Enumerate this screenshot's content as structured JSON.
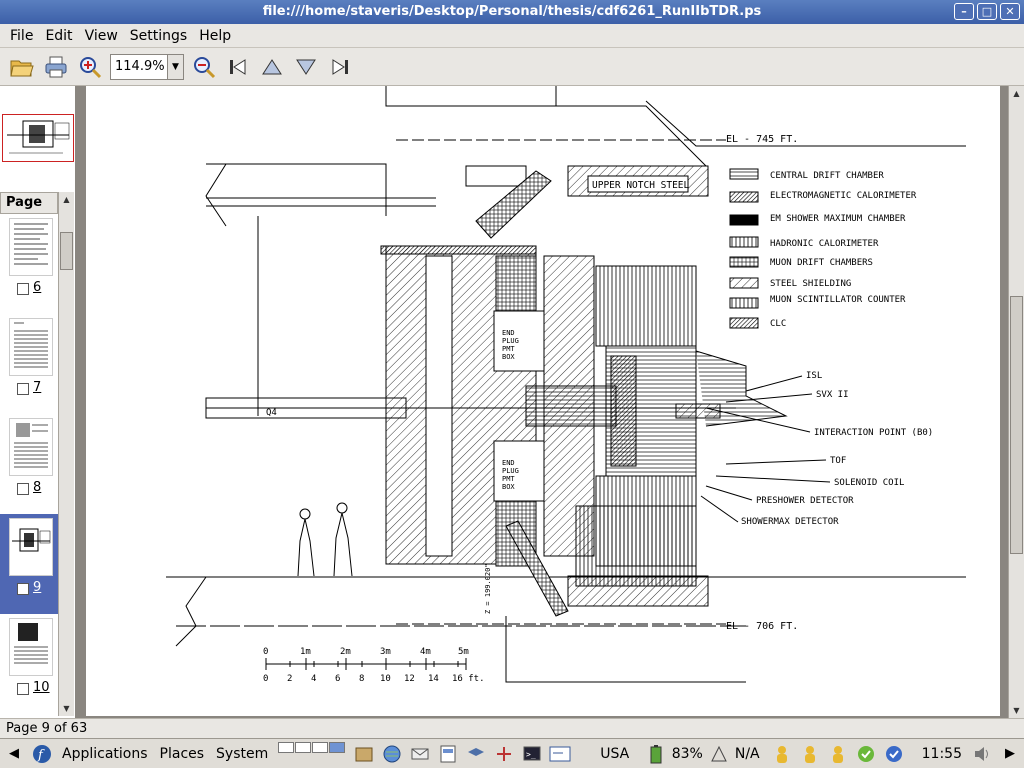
{
  "window": {
    "title": "file:///home/staveris/Desktop/Personal/thesis/cdf6261_RunIIbTDR.ps"
  },
  "menu": [
    "File",
    "Edit",
    "View",
    "Settings",
    "Help"
  ],
  "toolbar": {
    "zoom_value": "114.9%",
    "icons": [
      "open-icon",
      "print-icon",
      "zoom-in-icon",
      "zoom-out-icon",
      "first-page-icon",
      "previous-page-icon",
      "next-page-icon",
      "last-page-icon"
    ]
  },
  "sidebar": {
    "header": "Page",
    "pages": [
      {
        "number": "6",
        "selected": false
      },
      {
        "number": "7",
        "selected": false
      },
      {
        "number": "8",
        "selected": false
      },
      {
        "number": "9",
        "selected": true
      },
      {
        "number": "10",
        "selected": false
      }
    ]
  },
  "document": {
    "elevations": {
      "top": "EL - 745 FT.",
      "bottom": "EL - 706 FT."
    },
    "upper_notch": "UPPER NOTCH STEEL",
    "plug_box": [
      "END",
      "PLUG",
      "PMT",
      "BOX"
    ],
    "q4": "Q4",
    "z_label": "Z = 199.020\"",
    "legend": [
      "CENTRAL DRIFT CHAMBER",
      "ELECTROMAGNETIC CALORIMETER",
      "EM SHOWER MAXIMUM CHAMBER",
      "HADRONIC CALORIMETER",
      "MUON DRIFT CHAMBERS",
      "STEEL SHIELDING",
      "MUON SCINTILLATOR COUNTER",
      "CLC"
    ],
    "callouts": [
      "ISL",
      "SVX II",
      "INTERACTION POINT (B0)",
      "TOF",
      "SOLENOID COIL",
      "PRESHOWER DETECTOR",
      "SHOWERMAX DETECTOR"
    ],
    "scale_m": [
      "0",
      "1m",
      "2m",
      "3m",
      "4m",
      "5m"
    ],
    "scale_ft": [
      "0",
      "2",
      "4",
      "6",
      "8",
      "10",
      "12",
      "14",
      "16 ft."
    ]
  },
  "status": {
    "text": "Page 9 of 63"
  },
  "taskbar": {
    "applications": "Applications",
    "places": "Places",
    "system": "System",
    "keyboard": "USA",
    "battery": "83%",
    "network": "N/A",
    "clock": "11:55"
  }
}
